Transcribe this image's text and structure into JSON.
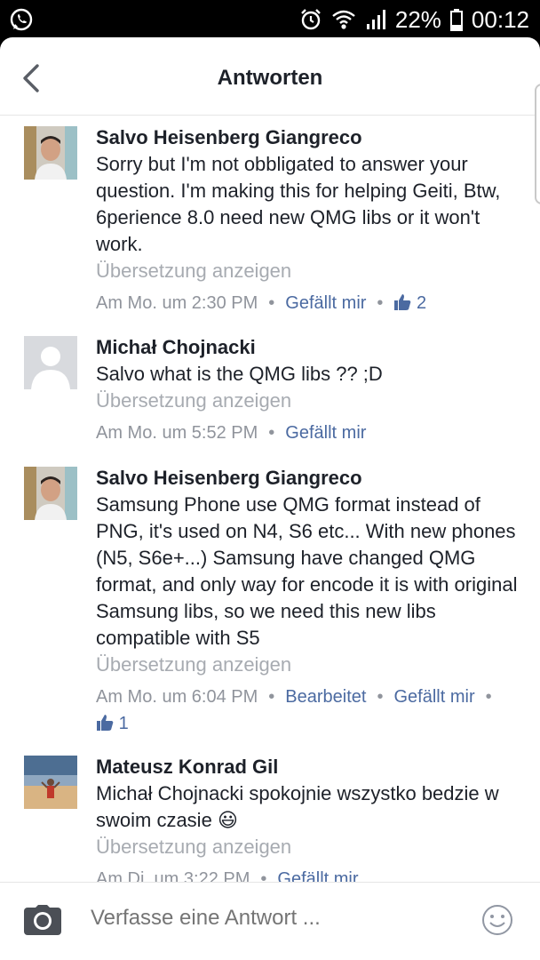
{
  "status_bar": {
    "battery": "22%",
    "time": "00:12"
  },
  "header": {
    "title": "Antworten"
  },
  "comments": [
    {
      "author": "Salvo Heisenberg Giangreco",
      "text": "Sorry but I'm not obbligated to answer your question. I'm making this for helping Geiti, Btw, 6perience 8.0 need new QMG libs or it won't work.",
      "translate": "Übersetzung anzeigen",
      "time": "Am Mo. um 2:30 PM",
      "like_label": "Gefällt mir",
      "likes": "2"
    },
    {
      "author": "Michał Chojnacki",
      "text": "Salvo what is the QMG libs ?? ;D",
      "translate": "Übersetzung anzeigen",
      "time": "Am Mo. um 5:52 PM",
      "like_label": "Gefällt mir"
    },
    {
      "author": "Salvo Heisenberg Giangreco",
      "text": "Samsung Phone use QMG format instead of PNG, it's used on N4, S6 etc... With new phones (N5, S6e+...) Samsung have changed QMG format, and only way for encode it is with original Samsung libs, so we need this new libs compatible with S5",
      "translate": "Übersetzung anzeigen",
      "time": "Am Mo. um 6:04 PM",
      "edited": "Bearbeitet",
      "like_label": "Gefällt mir",
      "likes": "1"
    },
    {
      "author": "Mateusz Konrad Gil",
      "text": "Michał Chojnacki spokojnie wszystko bedzie w swoim czasie",
      "emoji": "😃",
      "translate": "Übersetzung anzeigen",
      "time": "Am Di. um 3:22 PM",
      "like_label": "Gefällt mir"
    }
  ],
  "composer": {
    "placeholder": "Verfasse eine Antwort ..."
  },
  "colors": {
    "link": "#4b6aa1",
    "muted": "#90949c",
    "text": "#1d2129"
  }
}
